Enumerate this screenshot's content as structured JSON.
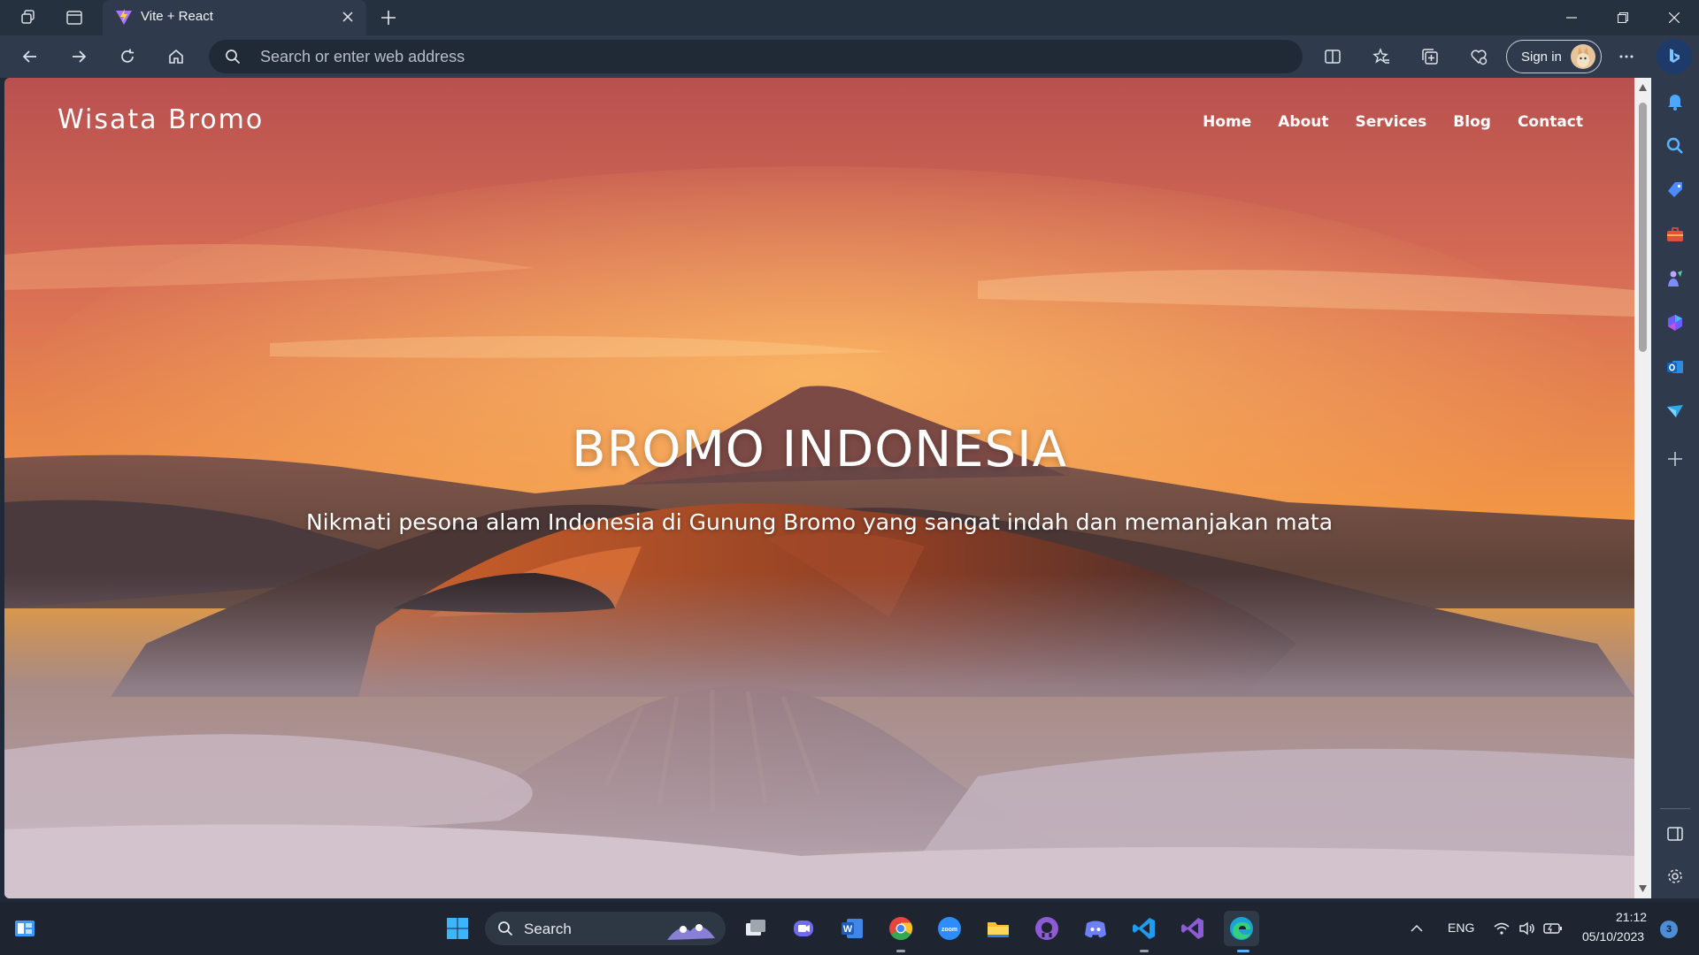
{
  "browser": {
    "tab": {
      "title": "Vite + React"
    },
    "address_bar": {
      "placeholder": "Search or enter web address"
    },
    "sign_in_label": "Sign in"
  },
  "page": {
    "logo": "Wisata Bromo",
    "nav": [
      "Home",
      "About",
      "Services",
      "Blog",
      "Contact"
    ],
    "hero": {
      "title": "BROMO INDONESIA",
      "subtitle": "Nikmati pesona alam Indonesia di Gunung Bromo yang sangat indah dan memanjakan mata"
    }
  },
  "taskbar": {
    "search_label": "Search",
    "language": "ENG",
    "time": "21:12",
    "date": "05/10/2023",
    "notification_count": "3",
    "apps": [
      "start-icon",
      "search-icon",
      "task-view-icon",
      "teams-icon",
      "word-icon",
      "chrome-icon",
      "zoom-icon",
      "file-explorer-icon",
      "github-icon",
      "discord-icon",
      "vscode-icon",
      "visual-studio-icon",
      "edge-icon"
    ]
  },
  "colors": {
    "titlebar": "#26313f",
    "toolbar": "#2f3b4c",
    "taskbar": "#1e2530",
    "sky_top": "#b9504e",
    "sky_horizon": "#f39a33"
  }
}
